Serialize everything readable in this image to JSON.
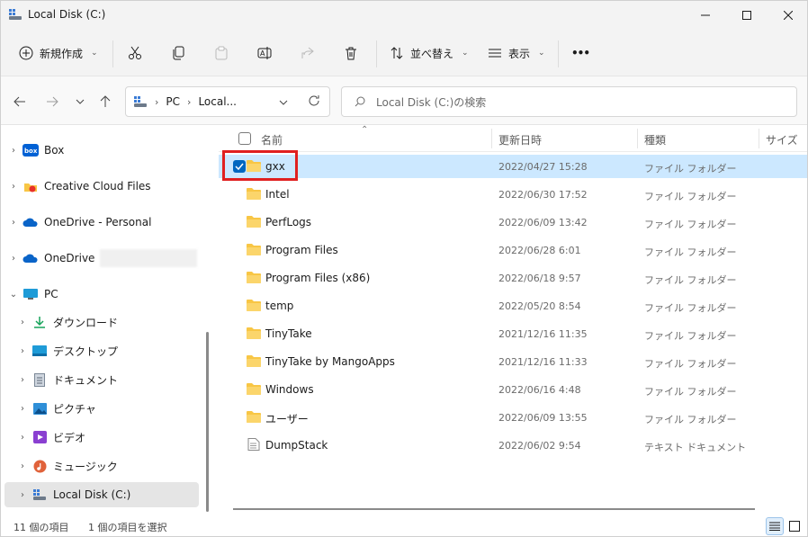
{
  "window": {
    "title": "Local Disk (C:)"
  },
  "toolbar": {
    "new_label": "新規作成",
    "sort_label": "並べ替え",
    "view_label": "表示",
    "more_label": "•••"
  },
  "address": {
    "crumbs": [
      "PC",
      "Local..."
    ]
  },
  "search": {
    "placeholder": "Local Disk (C:)の検索"
  },
  "sidebar": {
    "items": [
      {
        "label": "Box",
        "icon": "box-icon"
      },
      {
        "label": "Creative Cloud Files",
        "icon": "creative-cloud-icon"
      },
      {
        "label": "OneDrive - Personal",
        "icon": "onedrive-icon"
      },
      {
        "label": "OneDrive",
        "icon": "onedrive-icon"
      },
      {
        "label": "PC",
        "icon": "pc-icon"
      },
      {
        "label": "ダウンロード",
        "icon": "download-icon"
      },
      {
        "label": "デスクトップ",
        "icon": "desktop-icon"
      },
      {
        "label": "ドキュメント",
        "icon": "document-icon"
      },
      {
        "label": "ピクチャ",
        "icon": "picture-icon"
      },
      {
        "label": "ビデオ",
        "icon": "video-icon"
      },
      {
        "label": "ミュージック",
        "icon": "music-icon"
      },
      {
        "label": "Local Disk (C:)",
        "icon": "drive-icon"
      }
    ]
  },
  "columns": {
    "name": "名前",
    "date": "更新日時",
    "type": "種類",
    "size": "サイズ"
  },
  "files": [
    {
      "name": "gxx",
      "date": "2022/04/27 15:28",
      "type": "ファイル フォルダー",
      "kind": "folder",
      "selected": true
    },
    {
      "name": "Intel",
      "date": "2022/06/30 17:52",
      "type": "ファイル フォルダー",
      "kind": "folder"
    },
    {
      "name": "PerfLogs",
      "date": "2022/06/09 13:42",
      "type": "ファイル フォルダー",
      "kind": "folder"
    },
    {
      "name": "Program Files",
      "date": "2022/06/28 6:01",
      "type": "ファイル フォルダー",
      "kind": "folder"
    },
    {
      "name": "Program Files (x86)",
      "date": "2022/06/18 9:57",
      "type": "ファイル フォルダー",
      "kind": "folder"
    },
    {
      "name": "temp",
      "date": "2022/05/20 8:54",
      "type": "ファイル フォルダー",
      "kind": "folder"
    },
    {
      "name": "TinyTake",
      "date": "2021/12/16 11:35",
      "type": "ファイル フォルダー",
      "kind": "folder"
    },
    {
      "name": "TinyTake by MangoApps",
      "date": "2021/12/16 11:33",
      "type": "ファイル フォルダー",
      "kind": "folder"
    },
    {
      "name": "Windows",
      "date": "2022/06/16 4:48",
      "type": "ファイル フォルダー",
      "kind": "folder"
    },
    {
      "name": "ユーザー",
      "date": "2022/06/09 13:55",
      "type": "ファイル フォルダー",
      "kind": "folder"
    },
    {
      "name": "DumpStack",
      "date": "2022/06/02 9:54",
      "type": "テキスト ドキュメント",
      "kind": "text"
    }
  ],
  "status": {
    "count": "11 個の項目",
    "selected": "1 個の項目を選択"
  },
  "colors": {
    "selection": "#cce8ff",
    "accent": "#0067c0",
    "folder": "#f8c645",
    "highlight": "#e02020"
  }
}
